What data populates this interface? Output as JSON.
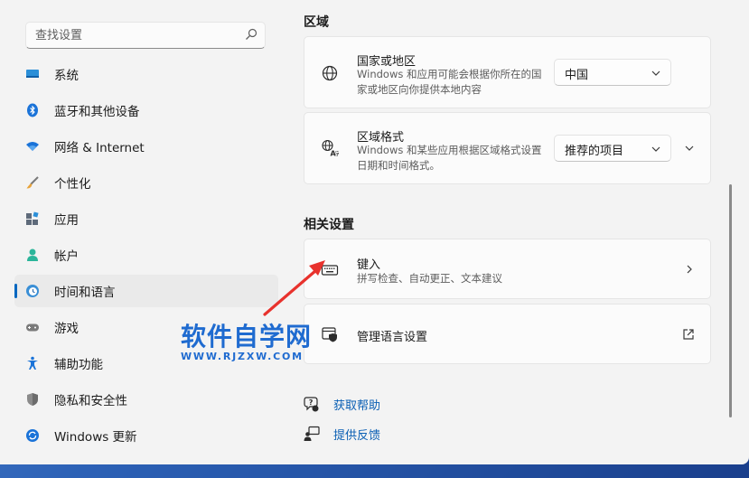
{
  "sidebar": {
    "search_placeholder": "查找设置",
    "items": [
      {
        "label": "系统",
        "icon": "monitor-icon"
      },
      {
        "label": "蓝牙和其他设备",
        "icon": "bluetooth-icon"
      },
      {
        "label": "网络 & Internet",
        "icon": "wifi-icon"
      },
      {
        "label": "个性化",
        "icon": "brush-icon"
      },
      {
        "label": "应用",
        "icon": "apps-icon"
      },
      {
        "label": "帐户",
        "icon": "person-icon"
      },
      {
        "label": "时间和语言",
        "icon": "clock-globe-icon",
        "selected": true
      },
      {
        "label": "游戏",
        "icon": "gamepad-icon"
      },
      {
        "label": "辅助功能",
        "icon": "accessibility-icon"
      },
      {
        "label": "隐私和安全性",
        "icon": "shield-icon"
      },
      {
        "label": "Windows 更新",
        "icon": "update-icon"
      }
    ]
  },
  "content": {
    "region_section": "区域",
    "country": {
      "title": "国家或地区",
      "desc": "Windows 和应用可能会根据你所在的国家或地区向你提供本地内容",
      "value": "中国"
    },
    "format": {
      "title": "区域格式",
      "desc": "Windows 和某些应用根据区域格式设置日期和时间格式。",
      "value": "推荐的项目"
    },
    "related_section": "相关设置",
    "typing": {
      "title": "键入",
      "desc": "拼写检查、自动更正、文本建议"
    },
    "manage_lang": {
      "title": "管理语言设置"
    },
    "links": {
      "help": "获取帮助",
      "feedback": "提供反馈"
    }
  },
  "watermark": {
    "main": "软件自学网",
    "sub": "WWW.RJZXW.COM"
  },
  "colors": {
    "accent": "#0067c0",
    "link": "#0a5fb4",
    "annotation_arrow": "#e8322d"
  }
}
